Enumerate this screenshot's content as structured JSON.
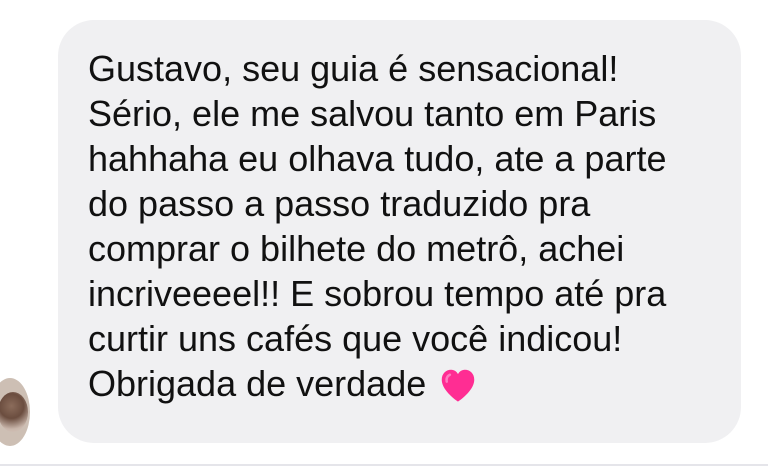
{
  "message": {
    "text": "Gustavo, seu guia é sensacional!\nSério, ele me salvou tanto em Paris\nhahhaha eu olhava tudo, ate a parte\ndo passo a passo traduzido pra\ncomprar o bilhete do metrô, achei\nincriveeeel!! E sobrou tempo até pra\ncurtir uns cafés que você indicou!\nObrigada de verdade",
    "emoji": "pink-heart-icon"
  },
  "colors": {
    "bubble": "#f0f0f2",
    "text": "#111111",
    "heart": "#ff2d93"
  }
}
